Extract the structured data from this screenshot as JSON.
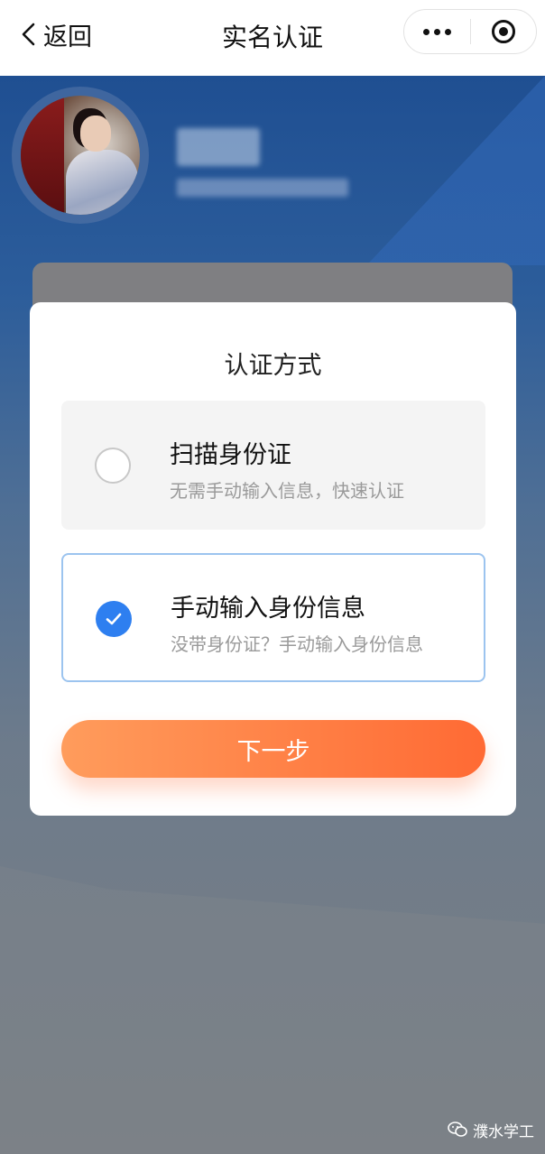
{
  "navbar": {
    "back_label": "返回",
    "title": "实名认证",
    "back_icon": "chevron-left-icon",
    "more_icon": "more-dots-icon",
    "close_icon": "target-circle-icon"
  },
  "modal": {
    "title": "认证方式",
    "options": [
      {
        "title": "扫描身份证",
        "subtitle": "无需手动输入信息，快速认证",
        "selected": false
      },
      {
        "title": "手动输入身份信息",
        "subtitle": "没带身份证？手动输入身份信息",
        "selected": true
      }
    ],
    "next_label": "下一步"
  },
  "colors": {
    "accent_blue": "#2e7ff0",
    "button_gradient_start": "#ff9c5c",
    "button_gradient_end": "#ff6a34",
    "selected_border": "#9cc4ef"
  },
  "watermark": {
    "text": "濮水学工",
    "icon": "wechat-icon"
  }
}
